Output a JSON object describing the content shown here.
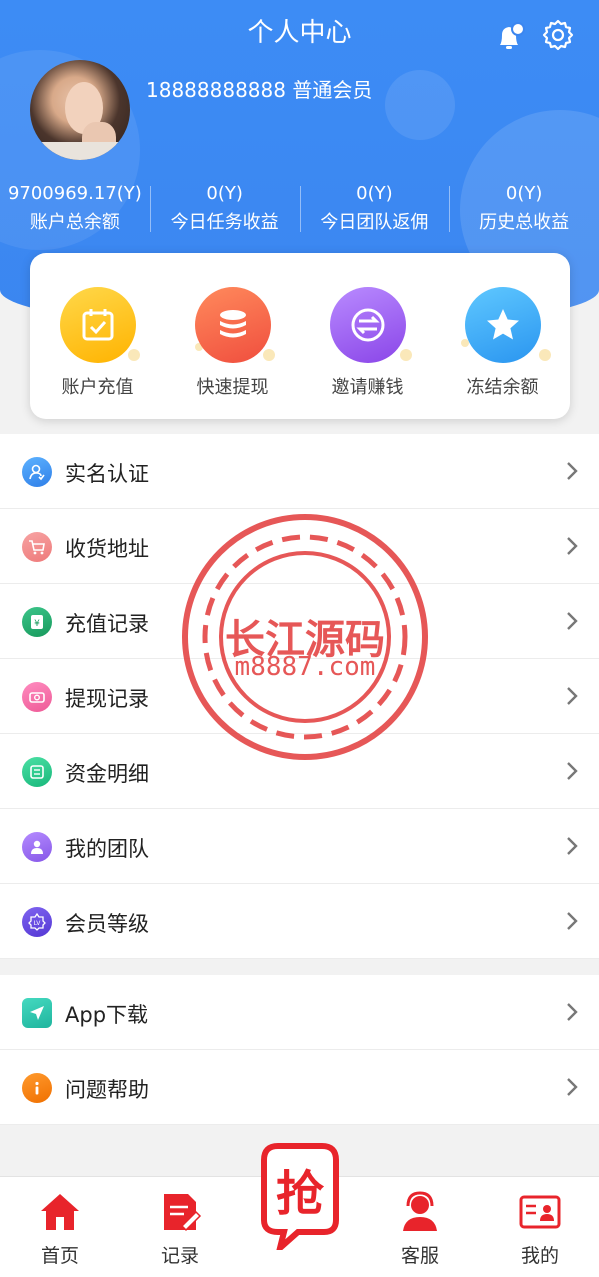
{
  "header": {
    "title": "个人中心",
    "user_line": "18888888888 普通会员"
  },
  "stats": [
    {
      "value": "9700969.17(Y)",
      "label": "账户总余额"
    },
    {
      "value": "0(Y)",
      "label": "今日任务收益"
    },
    {
      "value": "0(Y)",
      "label": "今日团队返佣"
    },
    {
      "value": "0(Y)",
      "label": "历史总收益"
    }
  ],
  "actions": [
    {
      "label": "账户充值",
      "icon": "calendar-check-icon",
      "color": "#ffc21a"
    },
    {
      "label": "快速提现",
      "icon": "coin-stack-icon",
      "color": "#f5644a"
    },
    {
      "label": "邀请赚钱",
      "icon": "exchange-icon",
      "color": "#9a5bf0"
    },
    {
      "label": "冻结余额",
      "icon": "star-icon",
      "color": "#3aa7f5"
    }
  ],
  "menu_main": [
    {
      "label": "实名认证",
      "icon": "user-verify-icon",
      "color": "#3b8cf2"
    },
    {
      "label": "收货地址",
      "icon": "cart-icon",
      "color": "#f08c8c"
    },
    {
      "label": "充值记录",
      "icon": "wallet-icon",
      "color": "#22a96e"
    },
    {
      "label": "提现记录",
      "icon": "money-icon",
      "color": "#f06aa0"
    },
    {
      "label": "资金明细",
      "icon": "ledger-icon",
      "color": "#25c98a"
    },
    {
      "label": "我的团队",
      "icon": "team-icon",
      "color": "#9a6df0"
    },
    {
      "label": "会员等级",
      "icon": "level-badge-icon",
      "color": "#6a4fe0"
    }
  ],
  "menu_other": [
    {
      "label": "App下载",
      "icon": "send-icon",
      "color": "#2fc7b0"
    },
    {
      "label": "问题帮助",
      "icon": "info-icon",
      "color": "#f57c0c"
    }
  ],
  "watermark": {
    "line1": "长江源码",
    "line2": "m8887.com"
  },
  "tabbar": {
    "home": "首页",
    "records": "记录",
    "grab": "抢",
    "service": "客服",
    "mine": "我的"
  }
}
